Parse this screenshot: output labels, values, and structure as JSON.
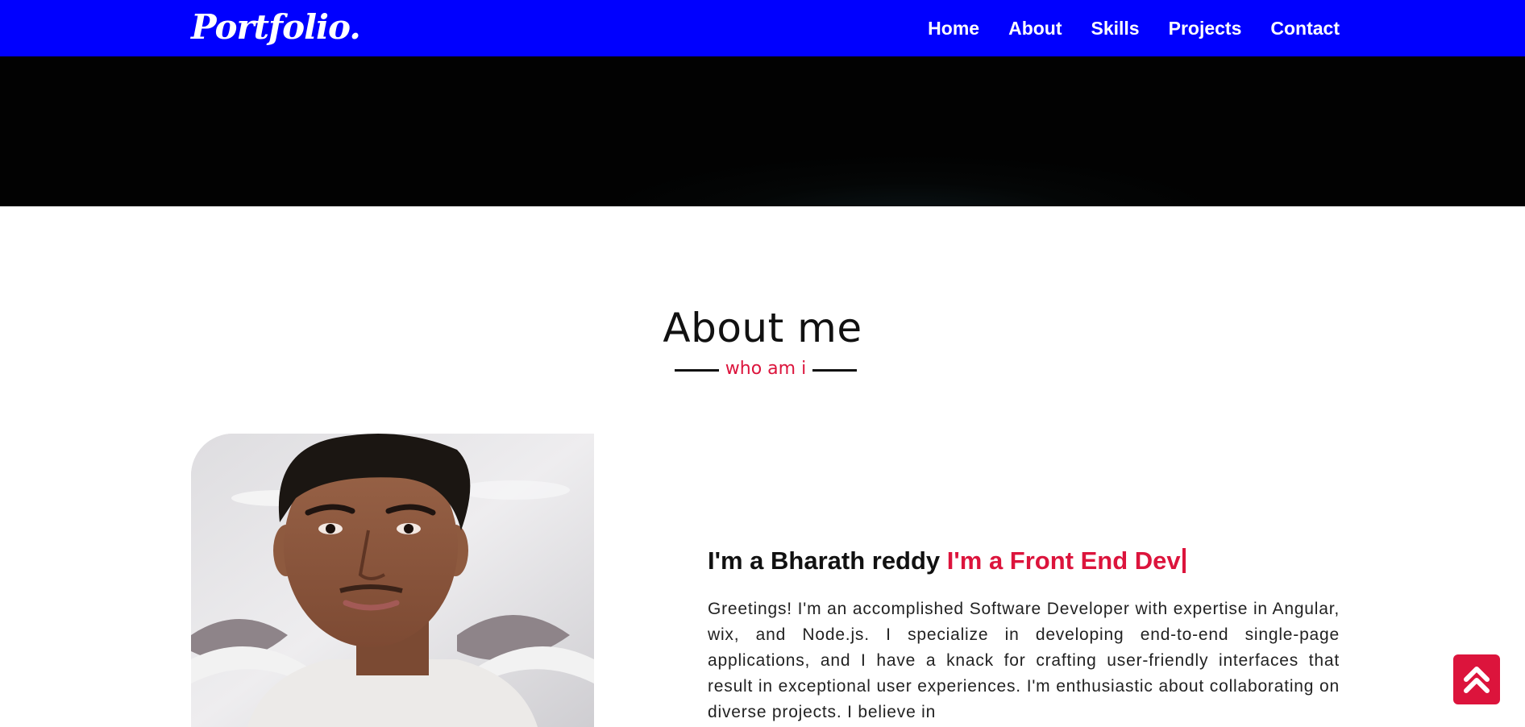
{
  "navbar": {
    "logo": "Portfolio.",
    "items": [
      {
        "label": "Home"
      },
      {
        "label": "About"
      },
      {
        "label": "Skills"
      },
      {
        "label": "Projects"
      },
      {
        "label": "Contact"
      }
    ],
    "background_color": "#0000ff"
  },
  "about": {
    "title": "About me",
    "subtitle": "who am i",
    "intro_static": "I'm a Bharath reddy ",
    "intro_typed": "I'm a Front End Dev",
    "description": "Greetings! I'm an accomplished Software Developer with expertise in Angular, wix, and Node.js. I specialize in developing end-to-end single-page applications, and I have a knack for crafting user-friendly interfaces that result in exceptional user experiences. I'm enthusiastic about collaborating on diverse projects. I believe in"
  },
  "scroll_top": {
    "icon": "double-chevron-up-icon"
  },
  "colors": {
    "accent": "#dc143c",
    "hero": "#030303"
  }
}
